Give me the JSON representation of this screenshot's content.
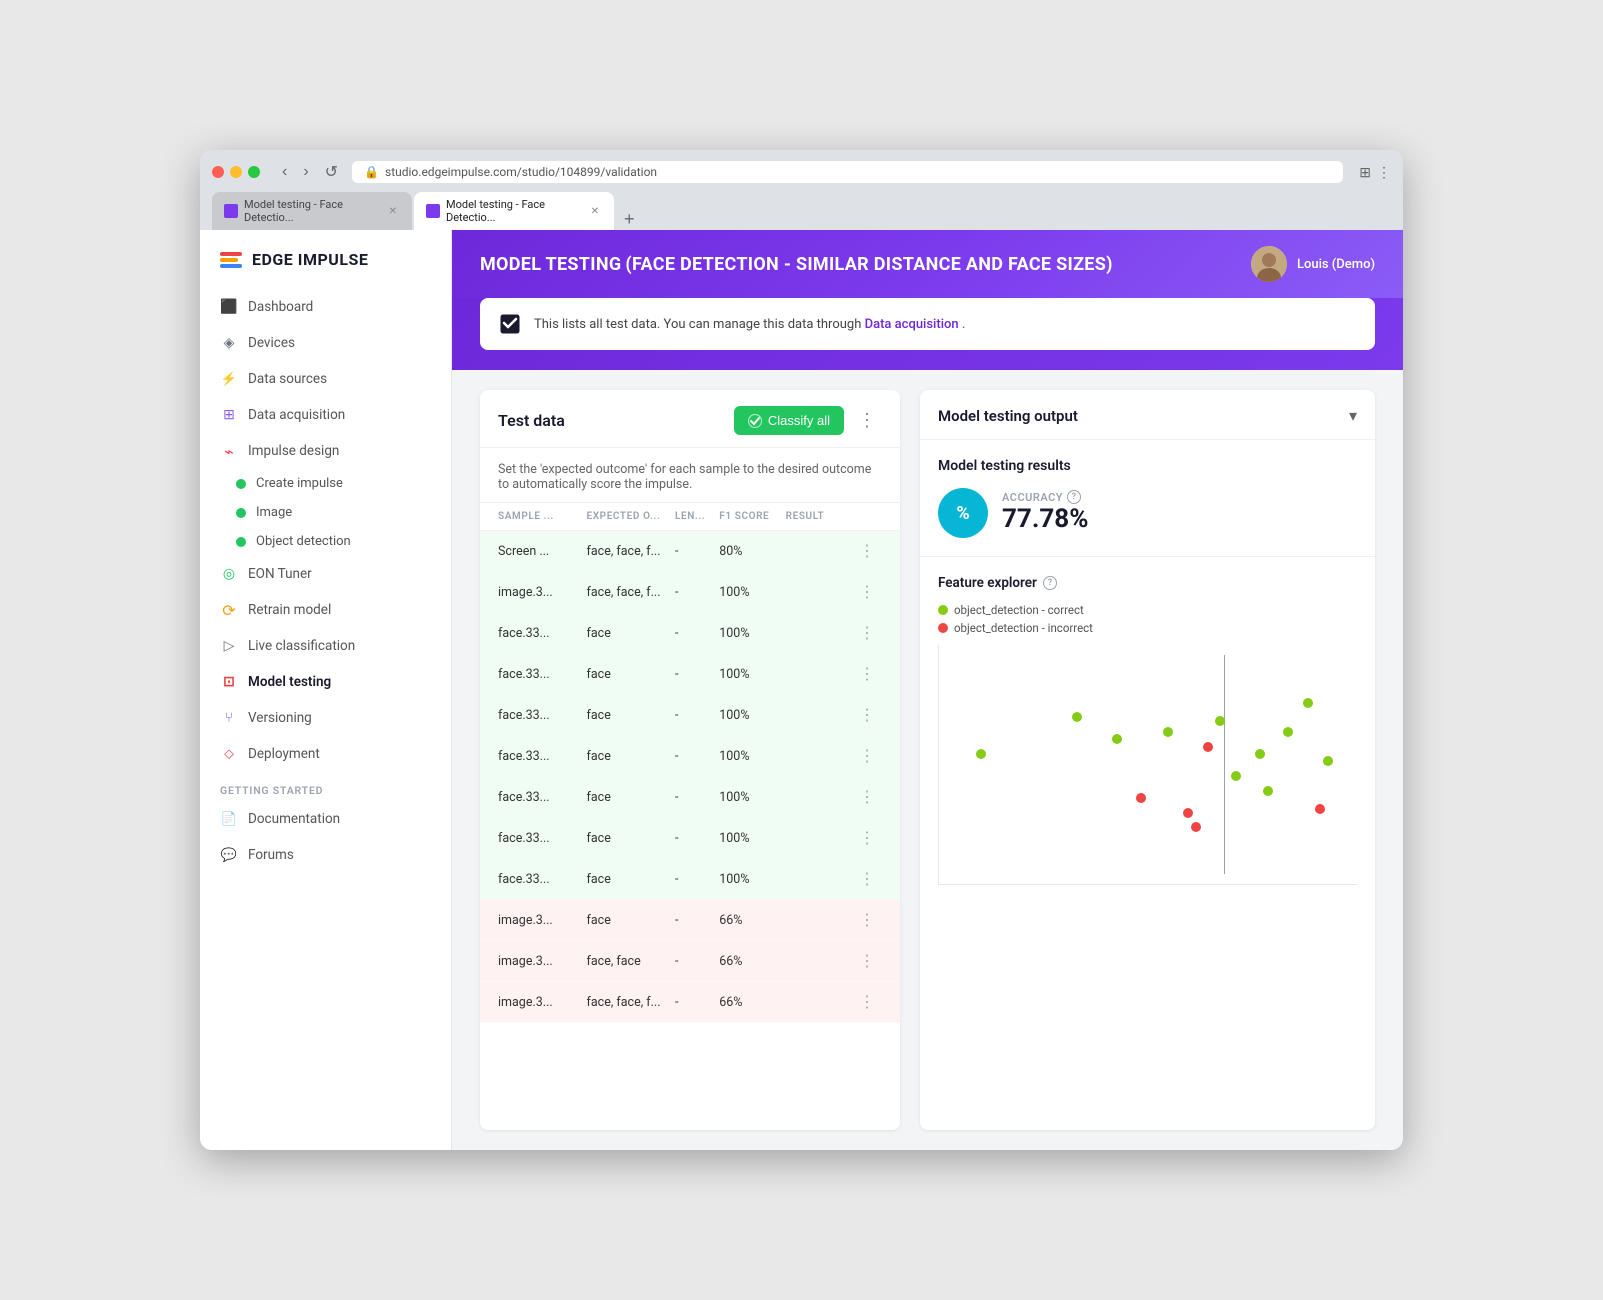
{
  "browser": {
    "url": "studio.edgeimpulse.com/studio/104899/validation",
    "tabs": [
      {
        "id": "tab1",
        "label": "Model testing - Face Detectio...",
        "active": false
      },
      {
        "id": "tab2",
        "label": "Model testing - Face Detectio...",
        "active": true
      }
    ],
    "new_tab_label": "+"
  },
  "sidebar": {
    "logo_text": "EDGE IMPULSE",
    "items": [
      {
        "id": "dashboard",
        "label": "Dashboard",
        "icon": "monitor"
      },
      {
        "id": "devices",
        "label": "Devices",
        "icon": "cpu"
      },
      {
        "id": "data-sources",
        "label": "Data sources",
        "icon": "data"
      },
      {
        "id": "data-acquisition",
        "label": "Data acquisition",
        "icon": "db"
      },
      {
        "id": "impulse-design",
        "label": "Impulse design",
        "icon": "impulse"
      },
      {
        "id": "eon-tuner",
        "label": "EON Tuner",
        "icon": "eon"
      },
      {
        "id": "retrain-model",
        "label": "Retrain model",
        "icon": "retrain"
      },
      {
        "id": "live-classification",
        "label": "Live classification",
        "icon": "live"
      },
      {
        "id": "model-testing",
        "label": "Model testing",
        "icon": "model",
        "active": true
      },
      {
        "id": "versioning",
        "label": "Versioning",
        "icon": "version"
      },
      {
        "id": "deployment",
        "label": "Deployment",
        "icon": "deploy"
      }
    ],
    "sub_items": [
      {
        "id": "create-impulse",
        "label": "Create impulse",
        "dot": "green"
      },
      {
        "id": "image",
        "label": "Image",
        "dot": "green"
      },
      {
        "id": "object-detection",
        "label": "Object detection",
        "dot": "green"
      }
    ],
    "getting_started_label": "GETTING STARTED",
    "getting_started_items": [
      {
        "id": "documentation",
        "label": "Documentation",
        "icon": "doc"
      },
      {
        "id": "forums",
        "label": "Forums",
        "icon": "forum"
      }
    ]
  },
  "header": {
    "title": "MODEL TESTING",
    "subtitle": "(FACE DETECTION - SIMILAR DISTANCE AND FACE SIZES)",
    "user_name": "Louis (Demo)"
  },
  "info_banner": {
    "text": "This lists all test data. You can manage this data through",
    "link_text": "Data acquisition",
    "text_after": "."
  },
  "test_data_panel": {
    "title": "Test data",
    "classify_btn_label": "Classify all",
    "description": "Set the 'expected outcome' for each sample to the desired outcome to automatically score the impulse.",
    "columns": [
      "SAMPLE ...",
      "EXPECTED O...",
      "LEN...",
      "F1 SCORE",
      "RESULT",
      ""
    ],
    "rows": [
      {
        "sample": "Screen ...",
        "expected": "face, face, f...",
        "len": "-",
        "f1": "80%",
        "result": "",
        "color": "green"
      },
      {
        "sample": "image.3...",
        "expected": "face, face, f...",
        "len": "-",
        "f1": "100%",
        "result": "",
        "color": "green"
      },
      {
        "sample": "face.33...",
        "expected": "face",
        "len": "-",
        "f1": "100%",
        "result": "",
        "color": "green"
      },
      {
        "sample": "face.33...",
        "expected": "face",
        "len": "-",
        "f1": "100%",
        "result": "",
        "color": "green"
      },
      {
        "sample": "face.33...",
        "expected": "face",
        "len": "-",
        "f1": "100%",
        "result": "",
        "color": "green"
      },
      {
        "sample": "face.33...",
        "expected": "face",
        "len": "-",
        "f1": "100%",
        "result": "",
        "color": "green"
      },
      {
        "sample": "face.33...",
        "expected": "face",
        "len": "-",
        "f1": "100%",
        "result": "",
        "color": "green"
      },
      {
        "sample": "face.33...",
        "expected": "face",
        "len": "-",
        "f1": "100%",
        "result": "",
        "color": "green"
      },
      {
        "sample": "face.33...",
        "expected": "face",
        "len": "-",
        "f1": "100%",
        "result": "",
        "color": "green"
      },
      {
        "sample": "image.3...",
        "expected": "face",
        "len": "-",
        "f1": "66%",
        "result": "",
        "color": "red"
      },
      {
        "sample": "image.3...",
        "expected": "face, face",
        "len": "-",
        "f1": "66%",
        "result": "",
        "color": "red"
      },
      {
        "sample": "image.3...",
        "expected": "face, face, f...",
        "len": "-",
        "f1": "66%",
        "result": "",
        "color": "red"
      }
    ]
  },
  "model_testing_output": {
    "title": "Model testing output",
    "results_title": "Model testing results",
    "accuracy_label": "ACCURACY",
    "accuracy_value": "77.78%",
    "accuracy_symbol": "%",
    "feature_explorer_title": "Feature explorer",
    "legend": [
      {
        "id": "correct",
        "label": "object_detection - correct",
        "color": "lime"
      },
      {
        "id": "incorrect",
        "label": "object_detection - incorrect",
        "color": "red"
      }
    ],
    "scatter_points": [
      {
        "x": 8,
        "y": 55,
        "color": "lime"
      },
      {
        "x": 32,
        "y": 72,
        "color": "lime"
      },
      {
        "x": 42,
        "y": 62,
        "color": "lime"
      },
      {
        "x": 48,
        "y": 35,
        "color": "red"
      },
      {
        "x": 55,
        "y": 65,
        "color": "lime"
      },
      {
        "x": 60,
        "y": 28,
        "color": "red"
      },
      {
        "x": 62,
        "y": 22,
        "color": "red"
      },
      {
        "x": 65,
        "y": 58,
        "color": "red"
      },
      {
        "x": 68,
        "y": 70,
        "color": "lime"
      },
      {
        "x": 72,
        "y": 45,
        "color": "lime"
      },
      {
        "x": 78,
        "y": 55,
        "color": "lime"
      },
      {
        "x": 80,
        "y": 38,
        "color": "lime"
      },
      {
        "x": 85,
        "y": 65,
        "color": "lime"
      },
      {
        "x": 90,
        "y": 78,
        "color": "lime"
      },
      {
        "x": 93,
        "y": 30,
        "color": "red"
      },
      {
        "x": 95,
        "y": 52,
        "color": "lime"
      }
    ]
  }
}
